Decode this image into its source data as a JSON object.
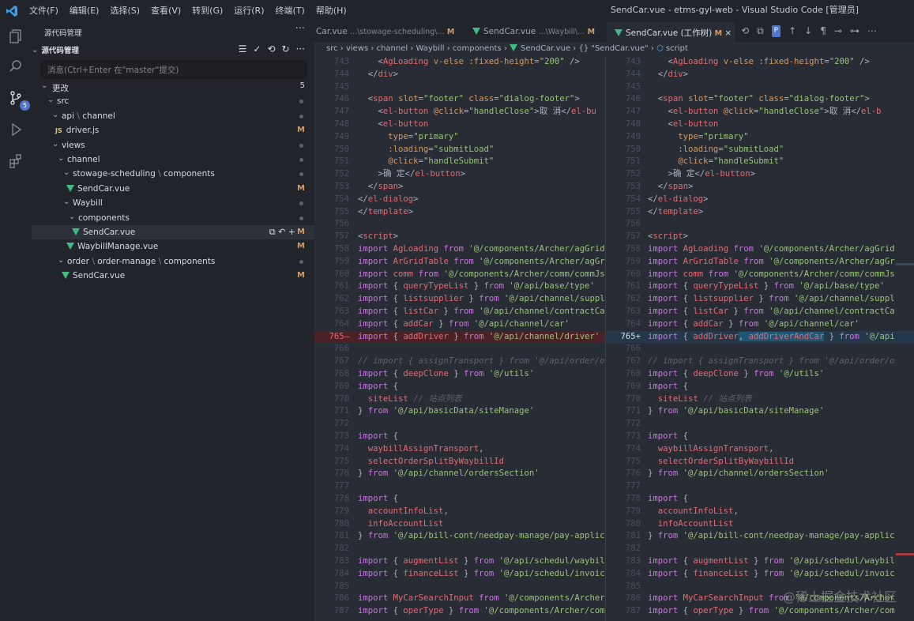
{
  "titlebar": {
    "menu": [
      "文件(F)",
      "编辑(E)",
      "选择(S)",
      "查看(V)",
      "转到(G)",
      "运行(R)",
      "终端(T)",
      "帮助(H)"
    ],
    "window_title": "SendCar.vue - etms-gyl-web - Visual Studio Code [管理员]"
  },
  "activity": {
    "icons": [
      "explorer-icon",
      "search-icon",
      "source-control-icon",
      "run-debug-icon",
      "extensions-icon"
    ],
    "scm_badge": "5"
  },
  "sidebar": {
    "title": "源代码管理",
    "more": "···",
    "section_label": "源代码管理",
    "commit_placeholder": "消息(Ctrl+Enter 在\"master\"提交)",
    "changes_label": "更改",
    "changes_count": "5",
    "tree": {
      "src": "src",
      "api": "api",
      "channel": "channel",
      "driver": "driver.js",
      "views": "views",
      "channel2": "channel",
      "stowage": "stowage-scheduling",
      "components": "components",
      "sendcar1": "SendCar.vue",
      "waybill": "Waybill",
      "components2": "components",
      "sendcar2": "SendCar.vue",
      "waybillmanage": "WaybillManage.vue",
      "order": "order",
      "ordermanage": "order-manage",
      "components3": "components",
      "sendcar3": "SendCar.vue",
      "sep": "\\",
      "status_m": "M"
    }
  },
  "tabs": [
    {
      "label": "Car.vue",
      "path": "...\\stowage-scheduling\\...",
      "status": "M"
    },
    {
      "label": "SendCar.vue",
      "path": "...\\Waybill\\...",
      "status": "M"
    },
    {
      "label": "SendCar.vue (工作树)",
      "path": "",
      "status": "M"
    }
  ],
  "breadcrumb": [
    "src",
    "views",
    "channel",
    "Waybill",
    "components",
    "SendCar.vue",
    "{} \"SendCar.vue\"",
    "script"
  ],
  "diff": {
    "left_line_765": "import { addDriver } from '@/api/channel/driver'",
    "right_line_765": "import { addDriver, addDriverAndCar } from '@/api"
  },
  "watermark": "@稀土掘金技术社区",
  "colors": {
    "background": "#282c34",
    "sidebar": "#21252b",
    "deleted_line": "#4a2125",
    "added_line": "#23394a",
    "modified": "#d19a66",
    "vue": "#42b883"
  }
}
